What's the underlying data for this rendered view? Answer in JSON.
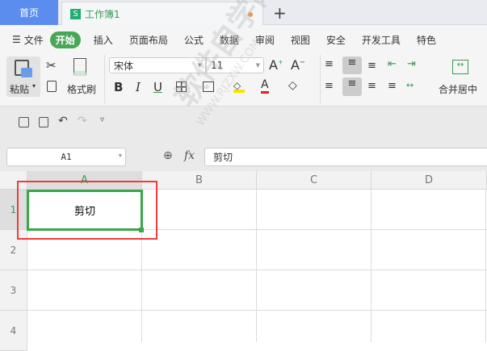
{
  "tabs": {
    "home": "首页",
    "workbook": "工作簿1",
    "workbook_icon": "S",
    "new_tab": "+"
  },
  "menu": {
    "hamburger": "☰",
    "items": [
      "文件",
      "开始",
      "插入",
      "页面布局",
      "公式",
      "数据",
      "审阅",
      "视图",
      "安全",
      "开发工具",
      "特色"
    ],
    "active": "开始"
  },
  "toolbar": {
    "paste": "粘贴",
    "format_painter": "格式刷",
    "font": "宋体",
    "size": "11",
    "bold": "B",
    "italic": "I",
    "underline": "U",
    "merge": "合并居中",
    "font_color": "#e02020",
    "highlight_color": "#f5e600"
  },
  "formula_bar": {
    "name_box": "A1",
    "fx": "fx",
    "value": "剪切"
  },
  "grid": {
    "columns": [
      "A",
      "B",
      "C",
      "D"
    ],
    "rows": [
      "1",
      "2",
      "3",
      "4"
    ],
    "cells": {
      "A1": "剪切"
    }
  },
  "watermark": {
    "text": "软件自学网",
    "url": "WWW.RJZXW.COM"
  }
}
